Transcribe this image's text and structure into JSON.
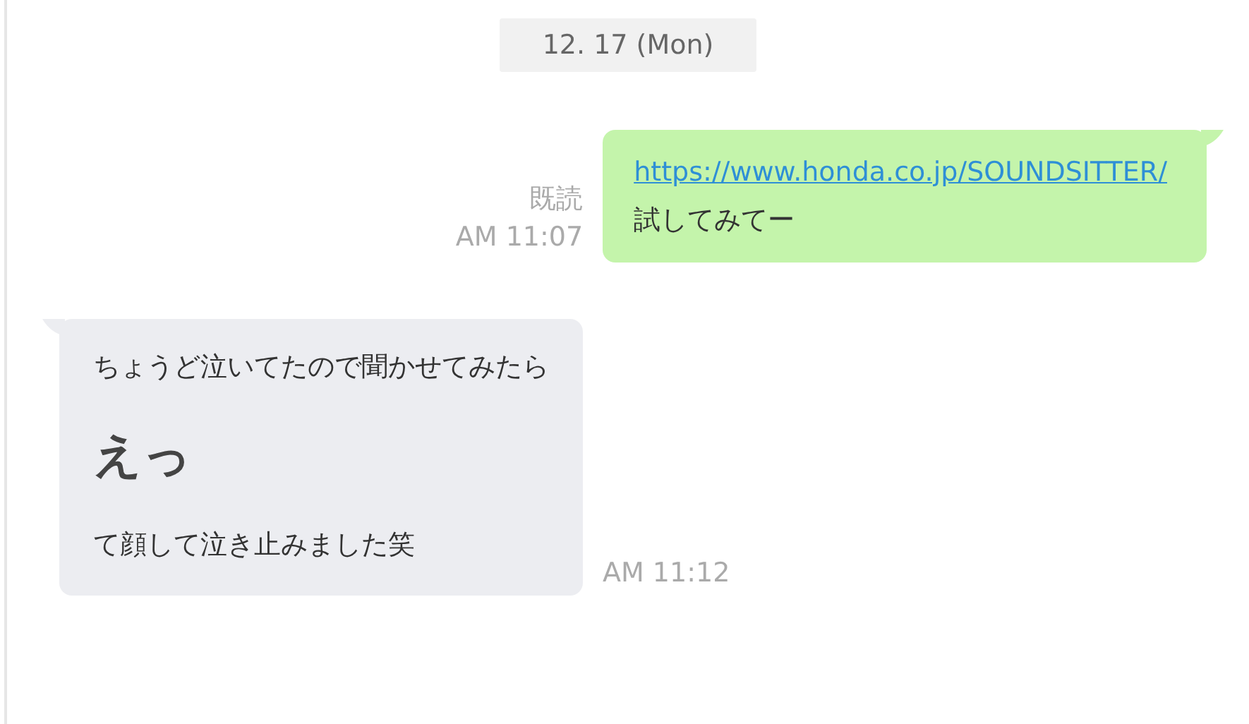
{
  "date_separator": "12. 17 (Mon)",
  "messages": [
    {
      "kind": "sent",
      "read_status": "既読",
      "time": "AM 11:07",
      "lines": [
        {
          "kind": "link",
          "text": "https://www.honda.co.jp/SOUNDSITTER/"
        },
        {
          "kind": "text",
          "text": "試してみてー"
        }
      ]
    },
    {
      "kind": "received",
      "time": "AM 11:12",
      "lines": [
        {
          "kind": "text",
          "text": "ちょうど泣いてたので聞かせてみたら"
        },
        {
          "kind": "big",
          "text": "えっ"
        },
        {
          "kind": "text",
          "text": "て顔して泣き止みました笑"
        }
      ]
    }
  ]
}
